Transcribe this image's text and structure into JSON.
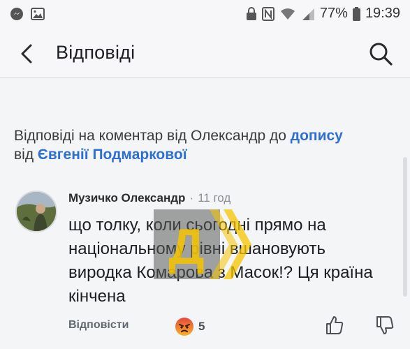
{
  "status_bar": {
    "battery": "77%",
    "time": "19:39"
  },
  "header": {
    "title": "Відповіді"
  },
  "context": {
    "prefix": "Відповіді на коментар від Олександр до ",
    "post_link": "допису",
    "middle": "від ",
    "author_link": "Євгенії Подмаркової"
  },
  "comment": {
    "author": "Музичко Олександр",
    "separator": "·",
    "time": "11 год",
    "text": "що толку, коли сьогодні прямо на національному рівні вшановують виродка Комарова з Масок!? Ця країна кінчена",
    "reply_label": "Відповісти",
    "reaction_count": "5"
  },
  "watermark": {
    "letter": "Д",
    "color": "#f5c400"
  },
  "colors": {
    "link": "#2e6fd1",
    "angry_reaction": "#e8453c"
  },
  "icons": [
    "back-arrow-icon",
    "search-icon",
    "angry-emoji-icon",
    "thumbs-up-icon",
    "thumbs-down-icon"
  ]
}
